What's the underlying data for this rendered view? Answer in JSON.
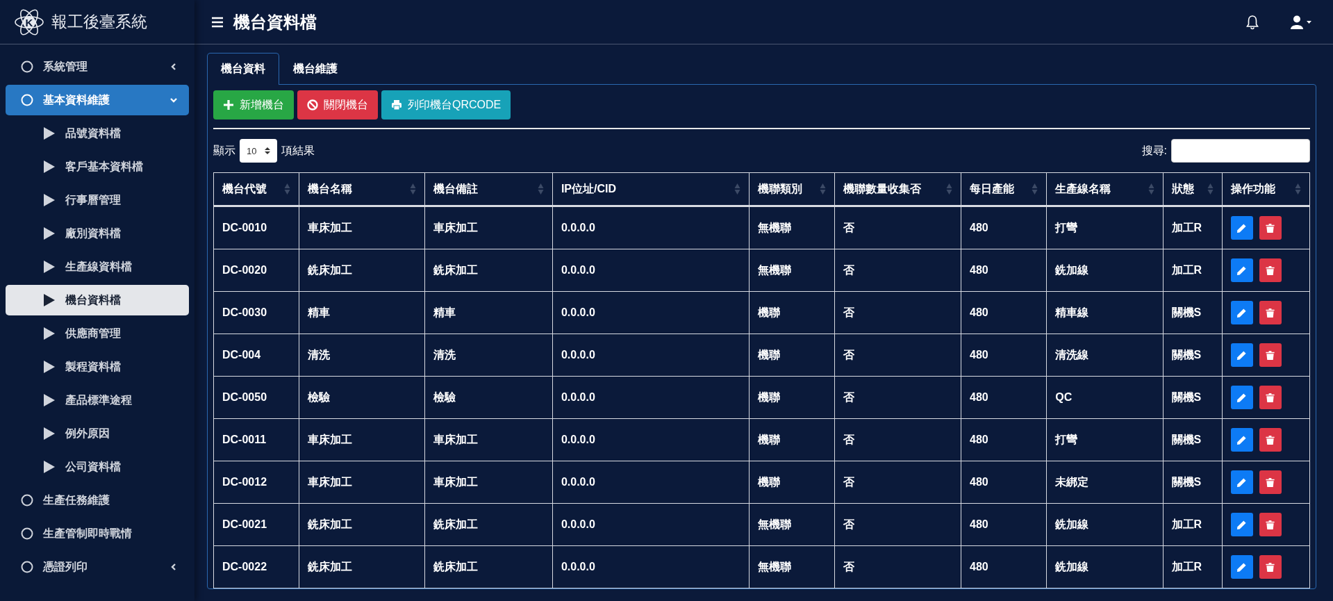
{
  "brand": {
    "logo_mark": "K",
    "title": "報工後臺系統"
  },
  "sidebar": {
    "items": [
      {
        "kind": "group",
        "label": "系統管理",
        "selected": false,
        "expanded": false
      },
      {
        "kind": "group",
        "label": "基本資料維護",
        "selected": true,
        "expanded": true,
        "children": [
          {
            "kind": "page",
            "label": "品號資料檔",
            "selected": false
          },
          {
            "kind": "page",
            "label": "客戶基本資料檔",
            "selected": false
          },
          {
            "kind": "page",
            "label": "行事曆管理",
            "selected": false
          },
          {
            "kind": "page",
            "label": "廠別資料檔",
            "selected": false
          },
          {
            "kind": "page",
            "label": "生產線資料檔",
            "selected": false
          },
          {
            "kind": "page",
            "label": "機台資料檔",
            "selected": true
          },
          {
            "kind": "page",
            "label": "供應商管理",
            "selected": false
          },
          {
            "kind": "page",
            "label": "製程資料檔",
            "selected": false
          },
          {
            "kind": "page",
            "label": "產品標準途程",
            "selected": false
          },
          {
            "kind": "page",
            "label": "例外原因",
            "selected": false
          },
          {
            "kind": "page",
            "label": "公司資料檔",
            "selected": false
          }
        ]
      },
      {
        "kind": "group",
        "label": "生產任務維護",
        "selected": false
      },
      {
        "kind": "group",
        "label": "生產管制即時戰情",
        "selected": false
      },
      {
        "kind": "group",
        "label": "憑證列印",
        "selected": false,
        "expanded": false
      }
    ]
  },
  "header": {
    "title": "機台資料檔"
  },
  "tabs": [
    {
      "label": "機台資料",
      "selected": true
    },
    {
      "label": "機台維護",
      "selected": false
    }
  ],
  "actions": [
    {
      "kind": "add",
      "label": "新增機台"
    },
    {
      "kind": "close",
      "label": "關閉機台"
    },
    {
      "kind": "print",
      "label": "列印機台QRCODE"
    }
  ],
  "length_control": {
    "prefix": "顯示",
    "value": "10",
    "suffix": "項結果"
  },
  "search": {
    "label": "搜尋:"
  },
  "table": {
    "columns": [
      "機台代號",
      "機台名稱",
      "機台備註",
      "IP位址/CID",
      "機聯類別",
      "機聯數量收集否",
      "每日產能",
      "生產線名稱",
      "狀態",
      "操作功能"
    ],
    "rows": [
      [
        "DC-0010",
        "車床加工",
        "車床加工",
        "0.0.0.0",
        "無機聯",
        "否",
        "480",
        "打彎",
        "加工R"
      ],
      [
        "DC-0020",
        "銑床加工",
        "銑床加工",
        "0.0.0.0",
        "無機聯",
        "否",
        "480",
        "銑加線",
        "加工R"
      ],
      [
        "DC-0030",
        "精車",
        "精車",
        "0.0.0.0",
        "機聯",
        "否",
        "480",
        "精車線",
        "關機S"
      ],
      [
        "DC-004",
        "清洗",
        "清洗",
        "0.0.0.0",
        "機聯",
        "否",
        "480",
        "清洗線",
        "關機S"
      ],
      [
        "DC-0050",
        "檢驗",
        "檢驗",
        "0.0.0.0",
        "機聯",
        "否",
        "480",
        "QC",
        "關機S"
      ],
      [
        "DC-0011",
        "車床加工",
        "車床加工",
        "0.0.0.0",
        "機聯",
        "否",
        "480",
        "打彎",
        "關機S"
      ],
      [
        "DC-0012",
        "車床加工",
        "車床加工",
        "0.0.0.0",
        "機聯",
        "否",
        "480",
        "未綁定",
        "關機S"
      ],
      [
        "DC-0021",
        "銑床加工",
        "銑床加工",
        "0.0.0.0",
        "無機聯",
        "否",
        "480",
        "銑加線",
        "加工R"
      ],
      [
        "DC-0022",
        "銑床加工",
        "銑床加工",
        "0.0.0.0",
        "無機聯",
        "否",
        "480",
        "銑加線",
        "加工R"
      ]
    ]
  }
}
